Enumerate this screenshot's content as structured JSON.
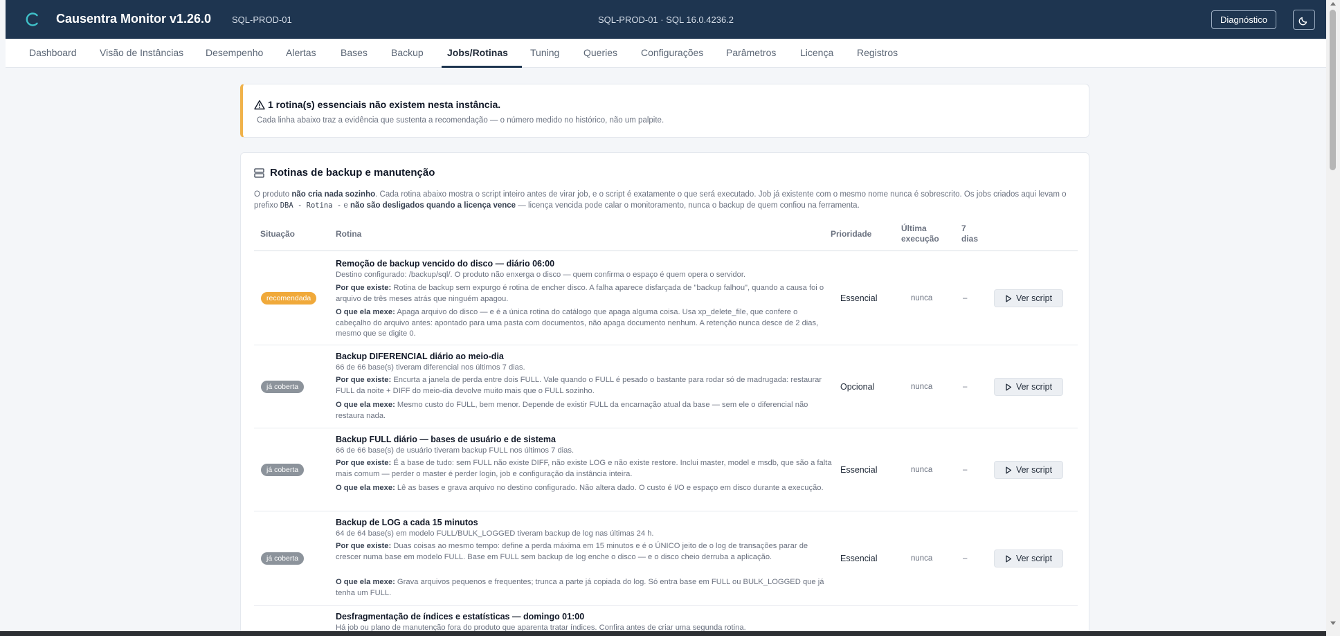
{
  "app": {
    "brand": "Causentra Monitor v1.26.0",
    "instance": "SQL-PROD-01",
    "server_info": "SQL-PROD-01 · SQL 16.0.4236.2",
    "diagnostic_label": "Diagnóstico",
    "theme_icon": "moon-icon",
    "accent_color": "#1e3550"
  },
  "nav": {
    "items": [
      {
        "label": "Dashboard"
      },
      {
        "label": "Visão de Instâncias"
      },
      {
        "label": "Desempenho"
      },
      {
        "label": "Alertas"
      },
      {
        "label": "Bases"
      },
      {
        "label": "Backup"
      },
      {
        "label": "Jobs/Rotinas",
        "active": true
      },
      {
        "label": "Tuning"
      },
      {
        "label": "Queries"
      },
      {
        "label": "Configurações"
      },
      {
        "label": "Parâmetros"
      },
      {
        "label": "Licença"
      },
      {
        "label": "Registros"
      }
    ]
  },
  "alert": {
    "title": "1 rotina(s) essenciais não existem nesta instância.",
    "subtitle": "Cada linha abaixo traz a evidência que sustenta a recomendação — o número medido no histórico, não um palpite."
  },
  "section": {
    "title": "Rotinas de backup e manutenção",
    "intro": {
      "p1": "O produto ",
      "b1": "não cria nada sozinho",
      "p2": ". Cada rotina abaixo mostra o script inteiro antes de virar job, e o script é exatamente o que será executado. Job já existente com o mesmo nome nunca é sobrescrito. Os jobs criados aqui levam o prefixo ",
      "code": "DBA - Rotina -",
      "p3": " e ",
      "b2": "não são desligados quando a licença vence",
      "p4": " — licença vencida pode calar o monitoramento, nunca o backup de quem confiou na ferramenta."
    }
  },
  "table": {
    "headers": {
      "status": "Situação",
      "routine": "Rotina",
      "priority": "Prioridade",
      "last_run_1": "Última",
      "last_run_2": "execução",
      "seven_1": "7",
      "seven_2": "dias"
    },
    "why_label": "Por que existe:",
    "what_label": "O que ela mexe:",
    "script_label": "Ver script",
    "rows": [
      {
        "status": "recomendada",
        "title": "Remoção de backup vencido do disco — diário 06:00",
        "evidence": "Destino configurado: /backup/sql/. O produto não enxerga o disco — quem confirma o espaço é quem opera o servidor.",
        "why": "Rotina de backup sem expurgo é rotina de encher disco. A falha aparece disfarçada de \"backup falhou\", quando a causa foi o arquivo de três meses atrás que ninguém apagou.",
        "what": "Apaga arquivo do disco — e é a única rotina do catálogo que apaga alguma coisa. Usa xp_delete_file, que confere o cabeçalho do arquivo antes: apontado para uma pasta com documentos, não apaga documento nenhum. A retenção nunca desce de 2 dias, mesmo que se digite 0.",
        "priority": "Essencial",
        "last_run": "nunca",
        "seven_days": "–"
      },
      {
        "status": "já coberta",
        "title": "Backup DIFERENCIAL diário ao meio-dia",
        "evidence": "66 de 66 base(s) tiveram diferencial nos últimos 7 dias.",
        "why": "Encurta a janela de perda entre dois FULL. Vale quando o FULL é pesado o bastante para rodar só de madrugada: restaurar FULL da noite + DIFF do meio-dia devolve muito mais que o FULL sozinho.",
        "what": "Mesmo custo do FULL, bem menor. Depende de existir FULL da encarnação atual da base — sem ele o diferencial não restaura nada.",
        "priority": "Opcional",
        "last_run": "nunca",
        "seven_days": "–"
      },
      {
        "status": "já coberta",
        "title": "Backup FULL diário — bases de usuário e de sistema",
        "evidence": "66 de 66 base(s) de usuário tiveram backup FULL nos últimos 7 dias.",
        "why": "É a base de tudo: sem FULL não existe DIFF, não existe LOG e não existe restore. Inclui master, model e msdb, que são a falta mais comum — perder o master é perder login, job e configuração da instância inteira.",
        "what": "Lê as bases e grava arquivo no destino configurado. Não altera dado. O custo é I/O e espaço em disco durante a execução.",
        "priority": "Essencial",
        "last_run": "nunca",
        "seven_days": "–"
      },
      {
        "status": "já coberta",
        "title": "Backup de LOG a cada 15 minutos",
        "evidence": "64 de 64 base(s) em modelo FULL/BULK_LOGGED tiveram backup de log nas últimas 24 h.",
        "why": "Duas coisas ao mesmo tempo: define a perda máxima em 15 minutos e é o ÚNICO jeito de o log de transações parar de crescer numa base em modelo FULL. Base em FULL sem backup de log enche o disco — e o disco cheio derruba a aplicação.",
        "what": "Grava arquivos pequenos e frequentes; trunca a parte já copiada do log. Só entra base em FULL ou BULK_LOGGED que já tenha um FULL.",
        "priority": "Essencial",
        "last_run": "nunca",
        "seven_days": "–"
      },
      {
        "title": "Desfragmentação de índices e estatísticas — domingo 01:00",
        "evidence": "Há job ou plano de manutenção fora do produto que aparenta tratar índices. Confira antes de criar uma segunda rotina."
      }
    ]
  }
}
